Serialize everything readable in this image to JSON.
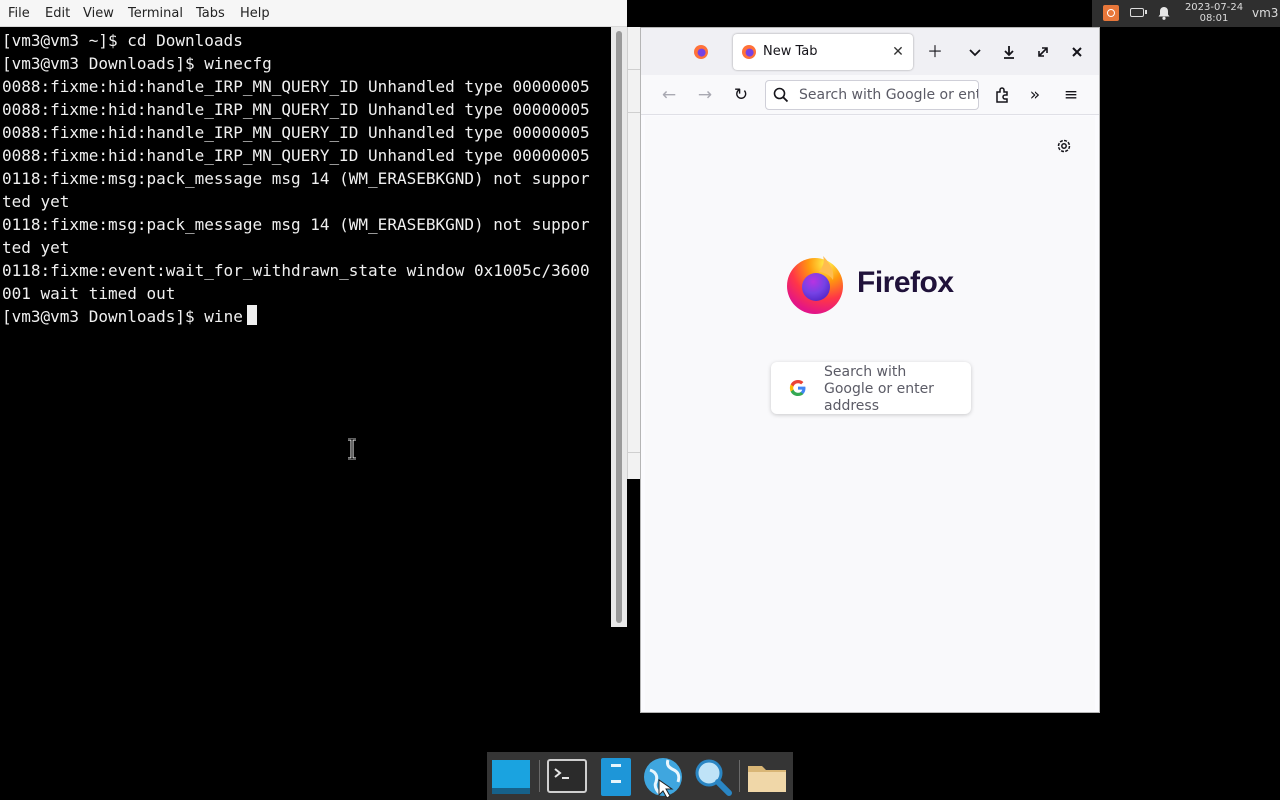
{
  "terminal": {
    "menu": [
      "File",
      "Edit",
      "View",
      "Terminal",
      "Tabs",
      "Help"
    ],
    "lines": [
      "[vm3@vm3 ~]$ cd Downloads",
      "[vm3@vm3 Downloads]$ winecfg",
      "0088:fixme:hid:handle_IRP_MN_QUERY_ID Unhandled type 00000005",
      "0088:fixme:hid:handle_IRP_MN_QUERY_ID Unhandled type 00000005",
      "0088:fixme:hid:handle_IRP_MN_QUERY_ID Unhandled type 00000005",
      "0088:fixme:hid:handle_IRP_MN_QUERY_ID Unhandled type 00000005",
      "0118:fixme:msg:pack_message msg 14 (WM_ERASEBKGND) not suppor",
      "ted yet",
      "0118:fixme:msg:pack_message msg 14 (WM_ERASEBKGND) not suppor",
      "ted yet",
      "0118:fixme:event:wait_for_withdrawn_state window 0x1005c/3600",
      "001 wait timed out"
    ],
    "prompt": "[vm3@vm3 Downloads]$ ",
    "current_input": "wine"
  },
  "top_panel": {
    "date": "2023-07-24",
    "time": "08:01",
    "user": "vm3"
  },
  "firefox": {
    "tab_title": "New Tab",
    "url_placeholder": "Search with Google or enter address",
    "wordmark": "Firefox",
    "search_text": "Search with Google or enter address"
  },
  "dock": {
    "items": [
      "show-desktop",
      "terminal",
      "file-manager",
      "web-browser",
      "search",
      "folder"
    ]
  }
}
